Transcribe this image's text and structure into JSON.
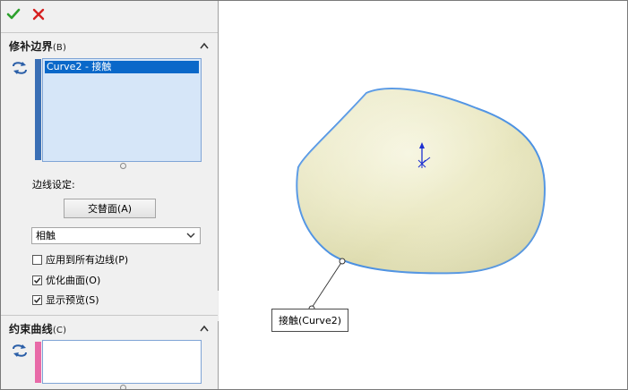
{
  "toolbar": {
    "ok_icon": "checkmark-icon",
    "cancel_icon": "x-close-icon",
    "ok_color": "#2ca02c",
    "cancel_color": "#d62020"
  },
  "boundary_section": {
    "title": "修补边界",
    "accel": "(B)",
    "selection_items": [
      "Curve2 - 接触"
    ],
    "edge_settings_label": "边线设定:",
    "alternate_face_button": "交替面(A)",
    "condition_value": "相触",
    "apply_all_edges_label": "应用到所有边线(P)",
    "apply_all_edges_checked": false,
    "optimize_surface_label": "优化曲面(O)",
    "optimize_surface_checked": true,
    "show_preview_label": "显示预览(S)",
    "show_preview_checked": true,
    "list_color": "#3a6fb5"
  },
  "constraint_section": {
    "title": "约束曲线",
    "accel": "(C)",
    "list_color": "#e86aa8"
  },
  "viewport": {
    "callout_label": "接触(Curve2)",
    "boundary_edge_color": "#4a90e2",
    "surface_color": "#ecebc8"
  }
}
